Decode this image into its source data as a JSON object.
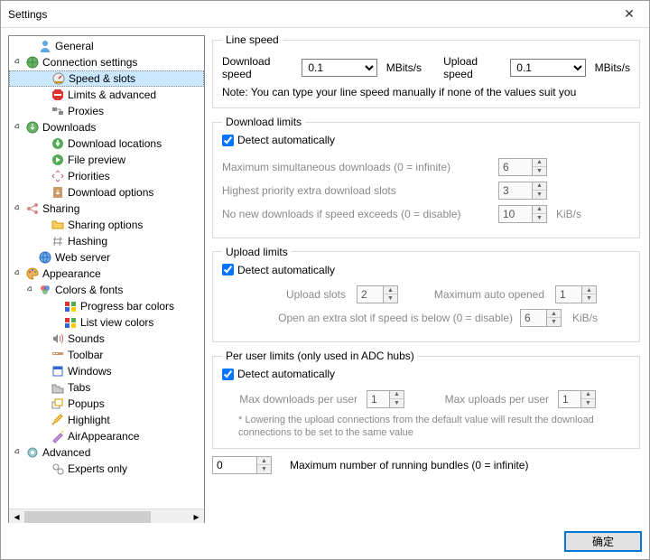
{
  "window": {
    "title": "Settings",
    "close": "✕"
  },
  "tree": {
    "general": "General",
    "connection": "Connection settings",
    "speed_slots": "Speed & slots",
    "limits_adv": "Limits & advanced",
    "proxies": "Proxies",
    "downloads": "Downloads",
    "dl_locations": "Download locations",
    "file_preview": "File preview",
    "priorities": "Priorities",
    "dl_options": "Download options",
    "sharing": "Sharing",
    "sharing_options": "Sharing options",
    "hashing": "Hashing",
    "web_server": "Web server",
    "appearance": "Appearance",
    "colors_fonts": "Colors & fonts",
    "progress_bar": "Progress bar colors",
    "list_view": "List view colors",
    "sounds": "Sounds",
    "toolbar": "Toolbar",
    "windows": "Windows",
    "tabs": "Tabs",
    "popups": "Popups",
    "highlight": "Highlight",
    "air": "AirAppearance",
    "advanced": "Advanced",
    "experts": "Experts only"
  },
  "line_speed": {
    "legend": "Line speed",
    "download_label": "Download speed",
    "download_value": "0.1",
    "upload_label": "Upload speed",
    "upload_value": "0.1",
    "unit": "MBits/s",
    "note": "Note: You can type your line speed manually if none of the values suit you"
  },
  "dl_limits": {
    "legend": "Download limits",
    "detect": "Detect automatically",
    "row1": "Maximum simultaneous downloads (0 = infinite)",
    "val1": "6",
    "row2": "Highest priority extra download slots",
    "val2": "3",
    "row3": "No new downloads if speed exceeds (0 = disable)",
    "val3": "10",
    "unit": "KiB/s"
  },
  "ul_limits": {
    "legend": "Upload limits",
    "detect": "Detect automatically",
    "slots_label": "Upload slots",
    "slots_val": "2",
    "max_auto_label": "Maximum auto opened",
    "max_auto_val": "1",
    "extra_label": "Open an extra slot if speed is below (0 = disable)",
    "extra_val": "6",
    "unit": "KiB/s"
  },
  "per_user": {
    "legend": "Per user limits (only used in ADC hubs)",
    "detect": "Detect automatically",
    "max_dl_label": "Max downloads per user",
    "max_dl_val": "1",
    "max_ul_label": "Max uploads per user",
    "max_ul_val": "1",
    "foot": "* Lowering the upload connections from the default value will result the download connections to be set to the same value"
  },
  "bundles": {
    "val": "0",
    "label": "Maximum number of running bundles (0 = infinite)"
  },
  "buttons": {
    "ok": "确定"
  }
}
